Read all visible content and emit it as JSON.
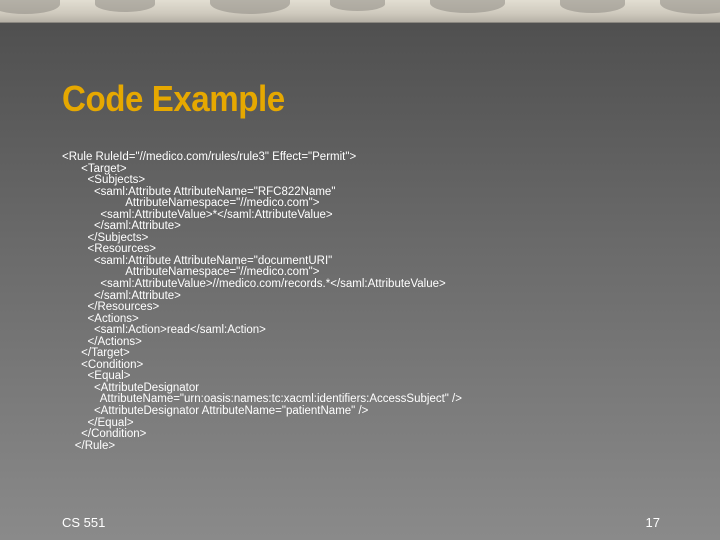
{
  "slide": {
    "title": "Code Example",
    "code_lines": [
      "<Rule RuleId=\"//medico.com/rules/rule3\" Effect=\"Permit\">",
      "      <Target>",
      "        <Subjects>",
      "          <saml:Attribute AttributeName=\"RFC822Name\"",
      "                    AttributeNamespace=\"//medico.com\">",
      "            <saml:AttributeValue>*</saml:AttributeValue>",
      "          </saml:Attribute>",
      "        </Subjects>",
      "        <Resources>",
      "          <saml:Attribute AttributeName=\"documentURI\"",
      "                    AttributeNamespace=\"//medico.com\">",
      "            <saml:AttributeValue>//medico.com/records.*</saml:AttributeValue>",
      "          </saml:Attribute>",
      "        </Resources>",
      "        <Actions>",
      "          <saml:Action>read</saml:Action>",
      "        </Actions>",
      "      </Target>",
      "      <Condition>",
      "        <Equal>",
      "          <AttributeDesignator",
      "            AttributeName=\"urn:oasis:names:tc:xacml:identifiers:AccessSubject\" />",
      "          <AttributeDesignator AttributeName=\"patientName\" />",
      "        </Equal>",
      "      </Condition>",
      "    </Rule>"
    ],
    "footer_left": "CS 551",
    "page_number": "17"
  }
}
